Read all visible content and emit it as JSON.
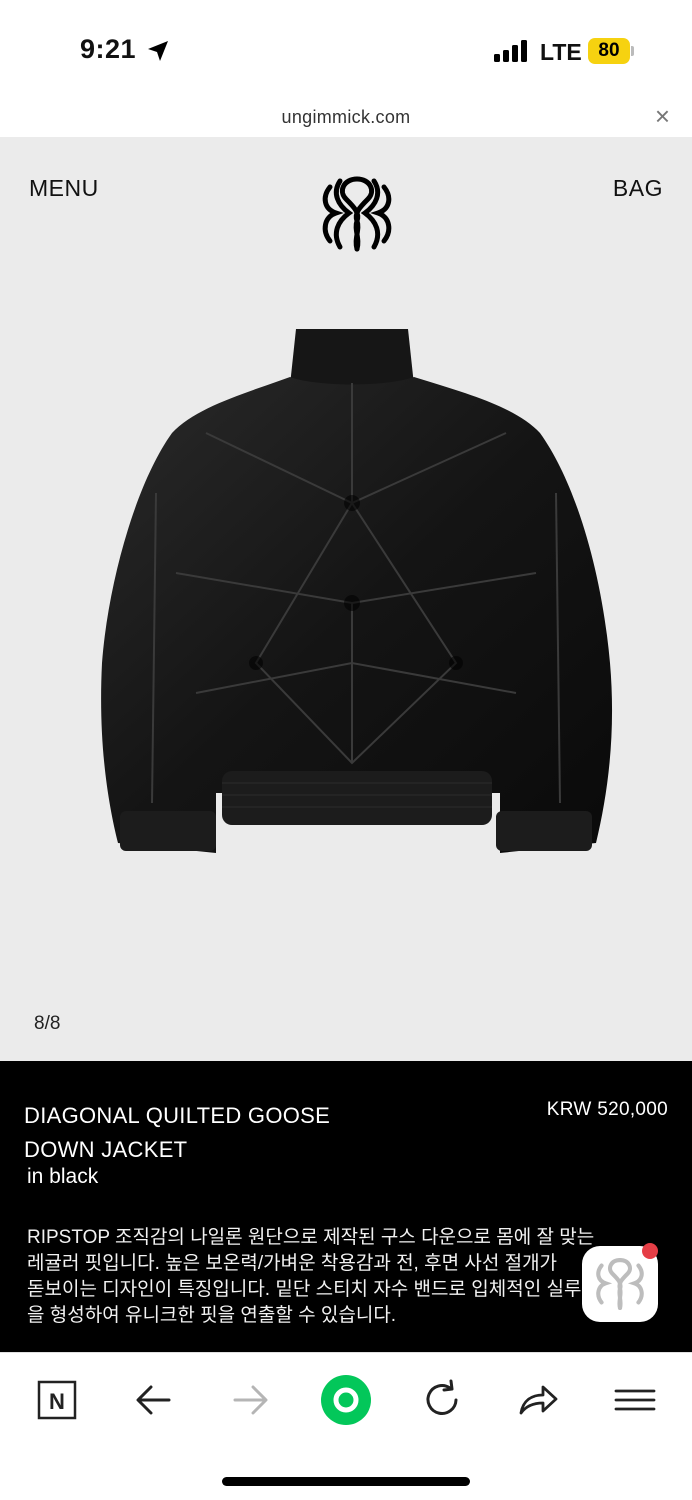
{
  "status_bar": {
    "time": "9:21",
    "network": "LTE",
    "battery": "80"
  },
  "browser": {
    "url": "ungimmick.com"
  },
  "header": {
    "menu_label": "MENU",
    "bag_label": "BAG"
  },
  "gallery": {
    "counter": "8/8"
  },
  "product": {
    "title": "DIAGONAL QUILTED GOOSE DOWN JACKET",
    "color": "in black",
    "price": "KRW 520,000",
    "description": "RIPSTOP 조직감의 나일론 원단으로 제작된 구스 다운으로 몸에 잘 맞는\n레귤러 핏입니다. 높은 보온력/가벼운 착용감과 전, 후면 사선 절개가\n돋보이는 디자인이 특징입니다. 밑단 스티치 자수 밴드로 입체적인 실루엣\n을 형성하여 유니크한 핏을 연출할 수 있습니다."
  },
  "colors": {
    "hero_bg": "#ebebeb",
    "info_bg": "#000000",
    "battery": "#f6d210",
    "naver_green": "#03c75a",
    "badge": "#e53e46"
  },
  "icons": {
    "toolbar": [
      "naver-n-icon",
      "back-arrow-icon",
      "forward-arrow-icon",
      "green-dot-icon",
      "reload-icon",
      "share-icon",
      "menu-icon"
    ]
  }
}
